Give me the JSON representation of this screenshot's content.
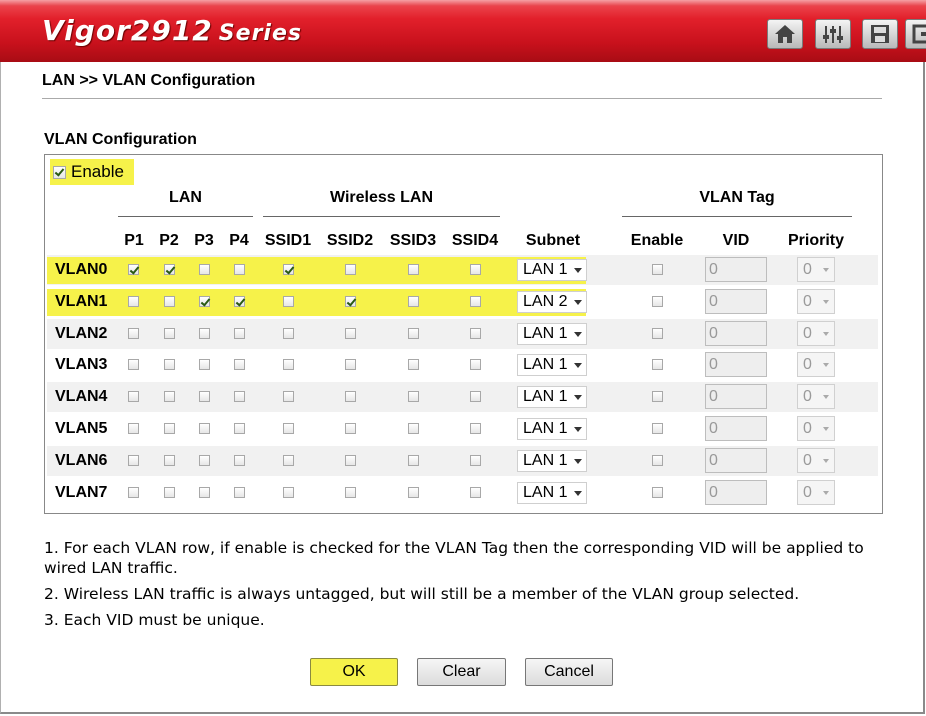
{
  "brand": {
    "model": "Vigor2912",
    "series": "Series"
  },
  "toolbar": {
    "icons": [
      "home-icon",
      "settings-icon",
      "save-icon",
      "logout-icon"
    ]
  },
  "breadcrumb": "LAN >> VLAN Configuration",
  "section_title": "VLAN Configuration",
  "enable": {
    "label": "Enable",
    "checked": true
  },
  "headers": {
    "lan": "LAN",
    "wireless": "Wireless LAN",
    "vlan_tag": "VLAN Tag",
    "ports": [
      "P1",
      "P2",
      "P3",
      "P4"
    ],
    "ssids": [
      "SSID1",
      "SSID2",
      "SSID3",
      "SSID4"
    ],
    "subnet": "Subnet",
    "tag_enable": "Enable",
    "vid": "VID",
    "priority": "Priority"
  },
  "rows": [
    {
      "name": "VLAN0",
      "ports": [
        true,
        true,
        false,
        false
      ],
      "ssids": [
        true,
        false,
        false,
        false
      ],
      "subnet": "LAN 1",
      "tag": false,
      "vid": "0",
      "priority": "0"
    },
    {
      "name": "VLAN1",
      "ports": [
        false,
        false,
        true,
        true
      ],
      "ssids": [
        false,
        true,
        false,
        false
      ],
      "subnet": "LAN 2",
      "tag": false,
      "vid": "0",
      "priority": "0"
    },
    {
      "name": "VLAN2",
      "ports": [
        false,
        false,
        false,
        false
      ],
      "ssids": [
        false,
        false,
        false,
        false
      ],
      "subnet": "LAN 1",
      "tag": false,
      "vid": "0",
      "priority": "0"
    },
    {
      "name": "VLAN3",
      "ports": [
        false,
        false,
        false,
        false
      ],
      "ssids": [
        false,
        false,
        false,
        false
      ],
      "subnet": "LAN 1",
      "tag": false,
      "vid": "0",
      "priority": "0"
    },
    {
      "name": "VLAN4",
      "ports": [
        false,
        false,
        false,
        false
      ],
      "ssids": [
        false,
        false,
        false,
        false
      ],
      "subnet": "LAN 1",
      "tag": false,
      "vid": "0",
      "priority": "0"
    },
    {
      "name": "VLAN5",
      "ports": [
        false,
        false,
        false,
        false
      ],
      "ssids": [
        false,
        false,
        false,
        false
      ],
      "subnet": "LAN 1",
      "tag": false,
      "vid": "0",
      "priority": "0"
    },
    {
      "name": "VLAN6",
      "ports": [
        false,
        false,
        false,
        false
      ],
      "ssids": [
        false,
        false,
        false,
        false
      ],
      "subnet": "LAN 1",
      "tag": false,
      "vid": "0",
      "priority": "0"
    },
    {
      "name": "VLAN7",
      "ports": [
        false,
        false,
        false,
        false
      ],
      "ssids": [
        false,
        false,
        false,
        false
      ],
      "subnet": "LAN 1",
      "tag": false,
      "vid": "0",
      "priority": "0"
    }
  ],
  "notes": [
    "1. For each VLAN row, if enable is checked for the VLAN Tag then the corresponding VID will be applied to wired LAN traffic.",
    "2. Wireless LAN traffic is always untagged, but will still be a member of the VLAN group selected.",
    "3. Each VID must be unique."
  ],
  "buttons": {
    "ok": "OK",
    "clear": "Clear",
    "cancel": "Cancel"
  },
  "colors": {
    "banner_red": "#d0141e",
    "highlight": "#f6f24a",
    "row_alt": "#f1f1f1"
  }
}
